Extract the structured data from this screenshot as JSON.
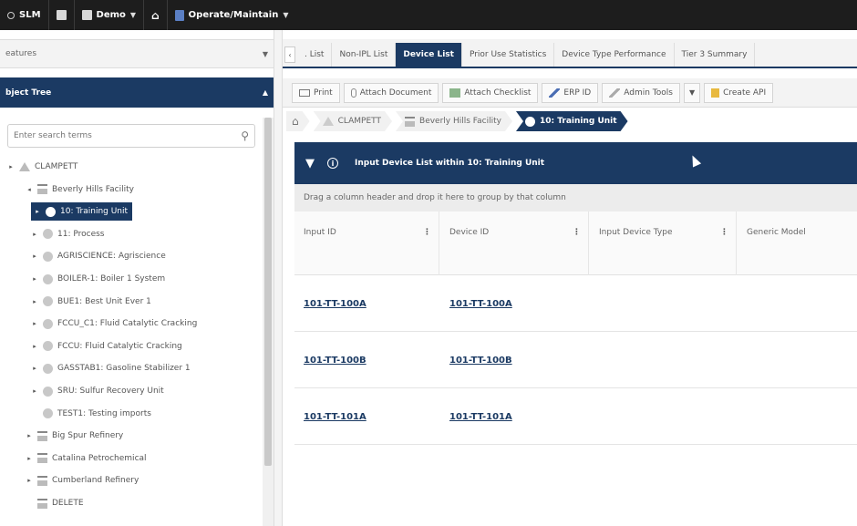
{
  "topbar": {
    "app": "SLM",
    "site": "Demo",
    "module": "Operate/Maintain"
  },
  "left": {
    "features_label": "eatures",
    "object_tree_label": "bject Tree",
    "search_placeholder": "Enter search terms",
    "tree": [
      {
        "label": "CLAMPETT",
        "level": 0,
        "expander": "▸"
      },
      {
        "label": "Beverly Hills Facility",
        "level": 1,
        "expander": "◂"
      },
      {
        "label": "10: Training Unit",
        "level": 2,
        "expander": "▸",
        "selected": true
      },
      {
        "label": "11: Process",
        "level": 2,
        "expander": "▸"
      },
      {
        "label": "AGRISCIENCE: Agriscience",
        "level": 2,
        "expander": "▸"
      },
      {
        "label": "BOILER-1: Boiler 1 System",
        "level": 2,
        "expander": "▸"
      },
      {
        "label": "BUE1: Best Unit Ever 1",
        "level": 2,
        "expander": "▸"
      },
      {
        "label": "FCCU_C1: Fluid Catalytic Cracking",
        "level": 2,
        "expander": "▸"
      },
      {
        "label": "FCCU: Fluid Catalytic Cracking",
        "level": 2,
        "expander": "▸"
      },
      {
        "label": "GASSTAB1: Gasoline Stabilizer 1",
        "level": 2,
        "expander": "▸"
      },
      {
        "label": "SRU: Sulfur Recovery Unit",
        "level": 2,
        "expander": "▸"
      },
      {
        "label": "TEST1: Testing imports",
        "level": 2,
        "expander": ""
      },
      {
        "label": "Big Spur Refinery",
        "level": 1,
        "expander": "▸"
      },
      {
        "label": "Catalina Petrochemical",
        "level": 1,
        "expander": "▸"
      },
      {
        "label": "Cumberland Refinery",
        "level": 1,
        "expander": "▸"
      },
      {
        "label": "DELETE",
        "level": 1,
        "expander": ""
      }
    ]
  },
  "tabs": [
    {
      "label": ". List"
    },
    {
      "label": "Non-IPL List"
    },
    {
      "label": "Device List",
      "active": true
    },
    {
      "label": "Prior Use Statistics"
    },
    {
      "label": "Device Type Performance"
    },
    {
      "label": "Tier 3 Summary"
    }
  ],
  "toolbar": {
    "print": "Print",
    "attach_document": "Attach Document",
    "attach_checklist": "Attach Checklist",
    "erp_id": "ERP ID",
    "admin_tools": "Admin Tools",
    "create": "Create API"
  },
  "breadcrumbs": [
    {
      "label": "CLAMPETT"
    },
    {
      "label": "Beverly Hills Facility"
    },
    {
      "label": "10: Training Unit",
      "active": true
    }
  ],
  "grid": {
    "title": "Input Device List within 10: Training Unit",
    "group_hint": "Drag a column header and drop it here to group by that column",
    "columns": [
      "Input ID",
      "Device ID",
      "Input Device Type",
      "Generic Model"
    ],
    "rows": [
      {
        "input_id": "101-TT-100A",
        "device_id": "101-TT-100A"
      },
      {
        "input_id": "101-TT-100B",
        "device_id": "101-TT-100B"
      },
      {
        "input_id": "101-TT-101A",
        "device_id": "101-TT-101A"
      }
    ]
  }
}
